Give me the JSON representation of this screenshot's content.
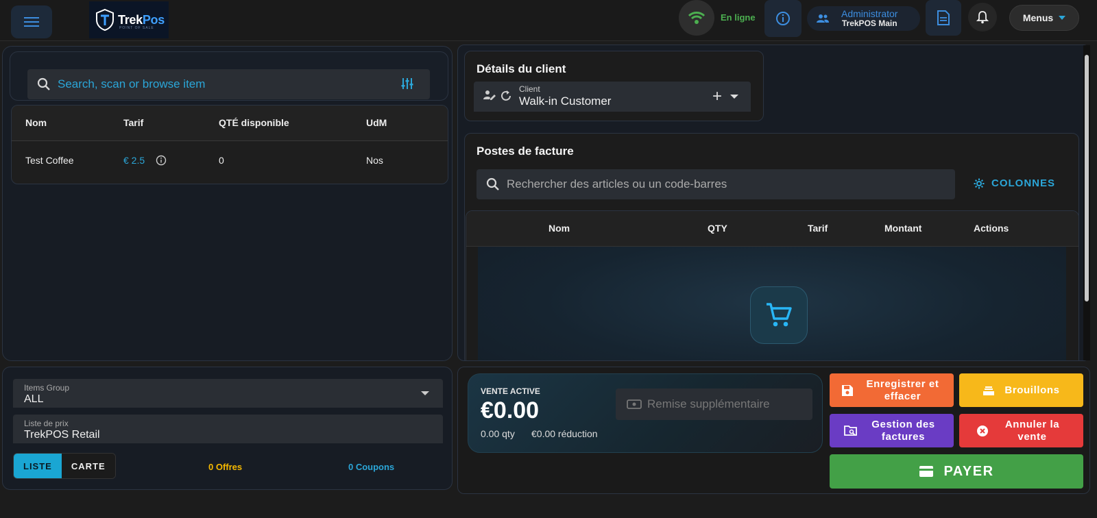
{
  "header": {
    "brand": "TrekPos",
    "brand_sub": "POINT OF SALE",
    "status": "En ligne",
    "user_role": "Administrator",
    "user_location": "TrekPOS Main",
    "menus_label": "Menus"
  },
  "items_search": {
    "placeholder": "Search, scan or browse item"
  },
  "items_table": {
    "columns": [
      "Nom",
      "Tarif",
      "QTÉ disponible",
      "UdM"
    ],
    "rows": [
      {
        "name": "Test Coffee",
        "price": "€ 2.5",
        "qty": "0",
        "uom": "Nos"
      }
    ]
  },
  "filters": {
    "items_group_label": "Items Group",
    "items_group_value": "ALL",
    "price_list_label": "Liste de prix",
    "price_list_value": "TrekPOS Retail",
    "view_list": "LISTE",
    "view_card": "CARTE",
    "offers": "0 Offres",
    "coupons": "0 Coupons"
  },
  "client": {
    "title": "Détails du client",
    "field_label": "Client",
    "field_value": "Walk-in Customer"
  },
  "invoice": {
    "title": "Postes de facture",
    "search_placeholder": "Rechercher des articles ou un code-barres",
    "columns_button": "COLONNES",
    "columns": [
      "Nom",
      "QTY",
      "Tarif",
      "Montant",
      "Actions"
    ]
  },
  "sale": {
    "label": "VENTE ACTIVE",
    "total": "€0.00",
    "qty": "0.00 qty",
    "discount": "€0.00 réduction",
    "extra_discount_placeholder": "Remise supplémentaire"
  },
  "actions": {
    "save": "Enregistrer et effacer",
    "drafts": "Brouillons",
    "manage_invoices": "Gestion des factures",
    "cancel_sale": "Annuler la vente",
    "pay": "PAYER"
  },
  "colors": {
    "accent": "#2ba6d8",
    "online": "#4caf50",
    "save": "#f26a35",
    "drafts": "#f7b81a",
    "manage": "#6a3cc4",
    "cancel": "#e53a3a",
    "pay": "#43a047"
  },
  "icons": [
    "hamburger-icon",
    "wifi-icon",
    "info-icon",
    "users-icon",
    "document-icon",
    "bell-icon",
    "search-icon",
    "tune-icon",
    "gear-icon",
    "cart-icon",
    "save-icon",
    "drafts-icon",
    "folder-search-icon",
    "cancel-icon",
    "card-icon"
  ]
}
